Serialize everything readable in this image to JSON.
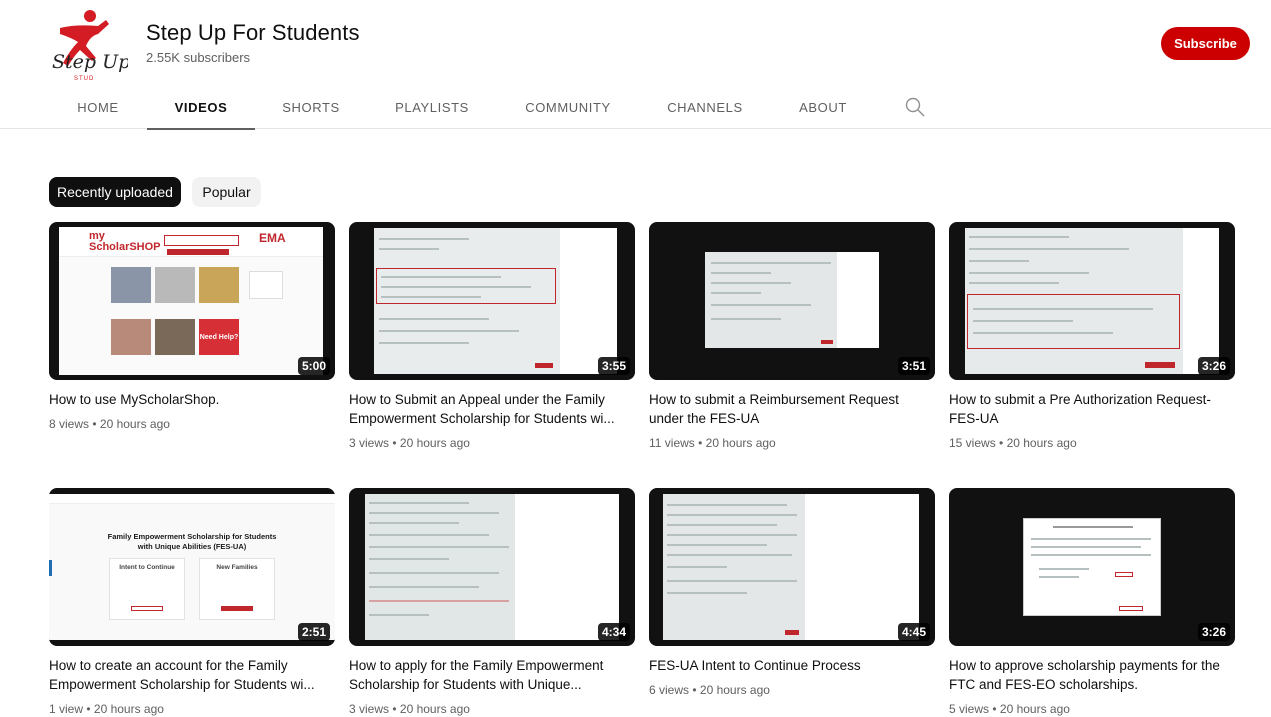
{
  "channel": {
    "name": "Step Up For Students",
    "subscribers": "2.55K subscribers",
    "logo_text": "Step Up",
    "subscribe_label": "Subscribe",
    "brand_color": "#cc0000"
  },
  "tabs": [
    {
      "label": "HOME",
      "active": false
    },
    {
      "label": "VIDEOS",
      "active": true
    },
    {
      "label": "SHORTS",
      "active": false
    },
    {
      "label": "PLAYLISTS",
      "active": false
    },
    {
      "label": "COMMUNITY",
      "active": false
    },
    {
      "label": "CHANNELS",
      "active": false
    },
    {
      "label": "ABOUT",
      "active": false
    }
  ],
  "search_icon": "search-icon",
  "chips": [
    {
      "label": "Recently uploaded",
      "active": true
    },
    {
      "label": "Popular",
      "active": false
    }
  ],
  "videos": [
    {
      "title": "How to use MyScholarShop.",
      "views": "8 views",
      "age": "20 hours ago",
      "duration": "5:00"
    },
    {
      "title": "How to Submit an Appeal under the Family Empowerment Scholarship for Students wi...",
      "views": "3 views",
      "age": "20 hours ago",
      "duration": "3:55"
    },
    {
      "title": "How to submit a Reimbursement Request under the FES-UA",
      "views": "11 views",
      "age": "20 hours ago",
      "duration": "3:51"
    },
    {
      "title": "How to submit a Pre Authorization Request-FES-UA",
      "views": "15 views",
      "age": "20 hours ago",
      "duration": "3:26"
    },
    {
      "title": "How to create an account for the Family Empowerment Scholarship for Students wi...",
      "views": "1 view",
      "age": "20 hours ago",
      "duration": "2:51"
    },
    {
      "title": "How to apply for the Family Empowerment Scholarship for Students with Unique...",
      "views": "3 views",
      "age": "20 hours ago",
      "duration": "4:34"
    },
    {
      "title": "FES-UA Intent to Continue Process",
      "views": "6 views",
      "age": "20 hours ago",
      "duration": "4:45"
    },
    {
      "title": "How to approve scholarship payments for the FTC and FES-EO scholarships.",
      "views": "5 views",
      "age": "20 hours ago",
      "duration": "3:26"
    }
  ],
  "thumb_text": {
    "myscholarshop_brand": "my ScholarSHOP",
    "need_help": "Need Help?",
    "ema_logo": "EMA",
    "fes_heading": "Family Empowerment Scholarship for Students with Unique Abilities (FES-UA)",
    "fes_intent": "Intent to Continue",
    "fes_new": "New Families"
  }
}
